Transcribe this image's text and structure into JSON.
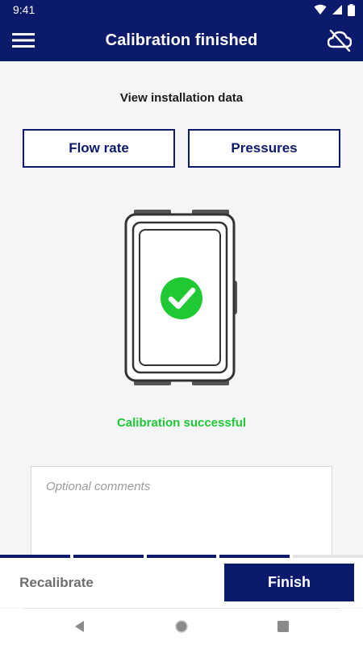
{
  "status_bar": {
    "time": "9:41",
    "icons": [
      "wifi-icon",
      "cellular-signal-icon",
      "battery-icon"
    ]
  },
  "app_bar": {
    "title": "Calibration finished",
    "left_icon": "hamburger-menu-icon",
    "right_icon": "cloud-off-icon"
  },
  "installation": {
    "label": "View installation data",
    "buttons": [
      "Flow rate",
      "Pressures"
    ]
  },
  "device": {
    "state_icon": "check-circle-icon",
    "status_text": "Calibration successful"
  },
  "comments": {
    "placeholder": "Optional comments",
    "value": ""
  },
  "progress": {
    "steps_total": 5,
    "steps_done": 4
  },
  "actions": {
    "recalibrate_label": "Recalibrate",
    "finish_label": "Finish"
  },
  "system_nav": [
    "back-icon",
    "home-icon",
    "recents-icon"
  ],
  "colors": {
    "primary": "#0c1a6b",
    "success": "#1ec934",
    "background": "#f4f5f7"
  }
}
